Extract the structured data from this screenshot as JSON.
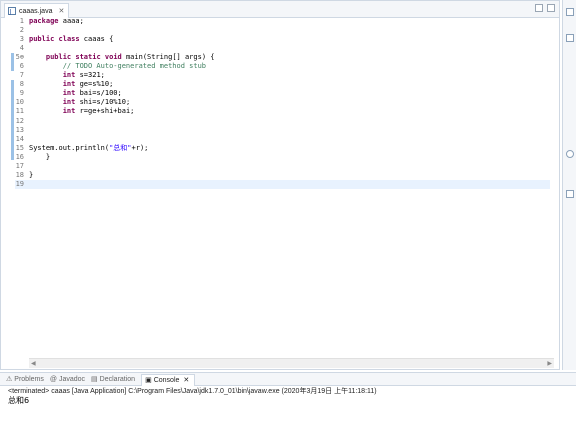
{
  "editor": {
    "tab_label": "caaas.java",
    "lines": [
      {
        "n": "1",
        "tokens": [
          {
            "t": "package",
            "c": "kw"
          },
          {
            "t": " aaaa;"
          }
        ]
      },
      {
        "n": "2",
        "tokens": []
      },
      {
        "n": "3",
        "tokens": [
          {
            "t": "public",
            "c": "kw"
          },
          {
            "t": " "
          },
          {
            "t": "class",
            "c": "kw"
          },
          {
            "t": " caaas {"
          }
        ]
      },
      {
        "n": "4",
        "tokens": []
      },
      {
        "n": "5⊕",
        "tokens": [
          {
            "t": "    "
          },
          {
            "t": "public",
            "c": "kw"
          },
          {
            "t": " "
          },
          {
            "t": "static",
            "c": "kw"
          },
          {
            "t": " "
          },
          {
            "t": "void",
            "c": "kw"
          },
          {
            "t": " main(String[] args) {"
          }
        ]
      },
      {
        "n": "6",
        "tokens": [
          {
            "t": "        "
          },
          {
            "t": "// TODO Auto-generated method stub",
            "c": "cm"
          }
        ]
      },
      {
        "n": "7",
        "tokens": [
          {
            "t": "        "
          },
          {
            "t": "int",
            "c": "kw"
          },
          {
            "t": " s=321;"
          }
        ]
      },
      {
        "n": "8",
        "tokens": [
          {
            "t": "        "
          },
          {
            "t": "int",
            "c": "kw"
          },
          {
            "t": " ge=s%10;"
          }
        ]
      },
      {
        "n": "9",
        "tokens": [
          {
            "t": "        "
          },
          {
            "t": "int",
            "c": "kw"
          },
          {
            "t": " bai=s/100;"
          }
        ]
      },
      {
        "n": "10",
        "tokens": [
          {
            "t": "        "
          },
          {
            "t": "int",
            "c": "kw"
          },
          {
            "t": " shi=s/10%10;"
          }
        ]
      },
      {
        "n": "11",
        "tokens": [
          {
            "t": "        "
          },
          {
            "t": "int",
            "c": "kw"
          },
          {
            "t": " r=ge+shi+bai;"
          }
        ]
      },
      {
        "n": "12",
        "tokens": []
      },
      {
        "n": "13",
        "tokens": []
      },
      {
        "n": "14",
        "tokens": []
      },
      {
        "n": "15",
        "tokens": [
          {
            "t": "System.out.println("
          },
          {
            "t": "\"",
            "c": "str"
          },
          {
            "t": "总和",
            "c": "str cjk"
          },
          {
            "t": "\"",
            "c": "str"
          },
          {
            "t": "+r);"
          }
        ]
      },
      {
        "n": "16",
        "tokens": [
          {
            "t": "    }"
          }
        ]
      },
      {
        "n": "17",
        "tokens": []
      },
      {
        "n": "18",
        "tokens": [
          {
            "t": "}"
          }
        ]
      },
      {
        "n": "19",
        "tokens": [],
        "current": true
      }
    ]
  },
  "views": {
    "tabs": [
      {
        "label": "Problems",
        "icon": "problems-icon",
        "glyph": "⚠",
        "active": false
      },
      {
        "label": "Javadoc",
        "icon": "javadoc-icon",
        "glyph": "@",
        "active": false
      },
      {
        "label": "Declaration",
        "icon": "declaration-icon",
        "glyph": "▤",
        "active": false
      },
      {
        "label": "Console",
        "icon": "console-icon",
        "glyph": "▣",
        "active": true
      }
    ]
  },
  "console": {
    "status": "<terminated> caaas [Java Application] C:\\Program Files\\Java\\jdk1.7.0_01\\bin\\javaw.exe (2020年3月19日 上午11:18:11)",
    "output": "总和6"
  },
  "colors": {
    "keyword": "#7f0055",
    "comment": "#3f7f5f",
    "string": "#2a00ff",
    "current_line": "#e8f2fe",
    "change_marker": "#9bc1e6"
  }
}
